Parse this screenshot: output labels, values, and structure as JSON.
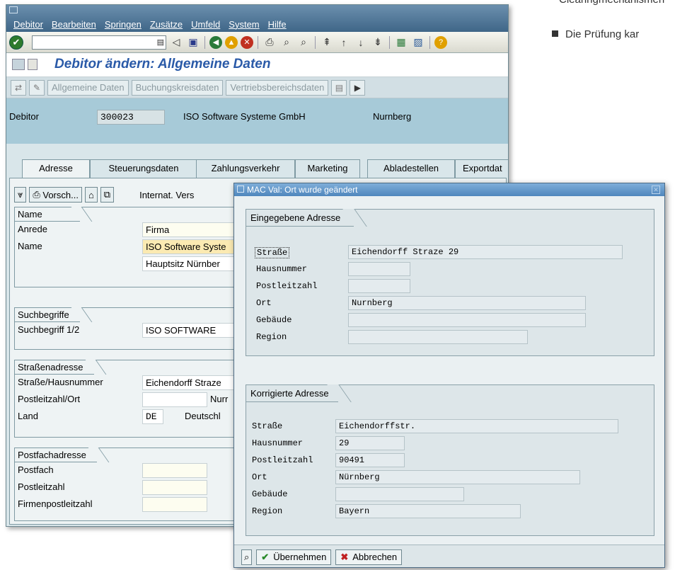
{
  "doc": {
    "line1": "Clearingmechanismen",
    "line2": "Die Prüfung kar"
  },
  "menu": [
    "Debitor",
    "Bearbeiten",
    "Springen",
    "Zusätze",
    "Umfeld",
    "System",
    "Hilfe"
  ],
  "title": "Debitor ändern: Allgemeine Daten",
  "app_toolbar": [
    "Allgemeine Daten",
    "Buchungskreisdaten",
    "Vertriebsbereichsdaten"
  ],
  "header": {
    "label": "Debitor",
    "number": "300023",
    "name": "ISO Software Systeme GmbH",
    "city": "Nurnberg"
  },
  "tabs": [
    "Adresse",
    "Steuerungsdaten",
    "Zahlungsverkehr",
    "Marketing",
    "Abladestellen",
    "Exportdat"
  ],
  "subtoolbar": {
    "preview": "Vorsch...",
    "intl": "Internat. Vers"
  },
  "groups": {
    "name": {
      "title": "Name",
      "anrede_label": "Anrede",
      "anrede": "Firma",
      "name_label": "Name",
      "name1": "ISO Software Syste",
      "name2": "Hauptsitz Nürnber"
    },
    "search": {
      "title": "Suchbegriffe",
      "label": "Suchbegriff 1/2",
      "value": "ISO SOFTWARE"
    },
    "street": {
      "title": "Straßenadresse",
      "street_label": "Straße/Hausnummer",
      "street": "Eichendorff Straze",
      "plz_label": "Postleitzahl/Ort",
      "city": "Nurr",
      "country_label": "Land",
      "country": "DE",
      "country_name": "Deutschl"
    },
    "pobox": {
      "title": "Postfachadresse",
      "pobox_label": "Postfach",
      "plz_label": "Postleitzahl",
      "firm_label": "Firmenpostleitzahl"
    }
  },
  "dialog": {
    "title": "MAC Val: Ort wurde geändert",
    "entered": {
      "title": "Eingegebene Adresse",
      "labels": [
        "Straße",
        "Hausnummer",
        "Postleitzahl",
        "Ort",
        "Gebäude",
        "Region"
      ],
      "values": [
        "Eichendorff Straze 29",
        "",
        "",
        "Nurnberg",
        "",
        ""
      ]
    },
    "corrected": {
      "title": "Korrigierte Adresse",
      "labels": [
        "Straße",
        "Hausnummer",
        "Postleitzahl",
        "Ort",
        "Gebäude",
        "Region"
      ],
      "values": [
        "Eichendorffstr.",
        "29",
        "90491",
        "Nürnberg",
        "",
        "Bayern"
      ]
    },
    "buttons": {
      "accept": "Übernehmen",
      "cancel": "Abbrechen"
    }
  }
}
